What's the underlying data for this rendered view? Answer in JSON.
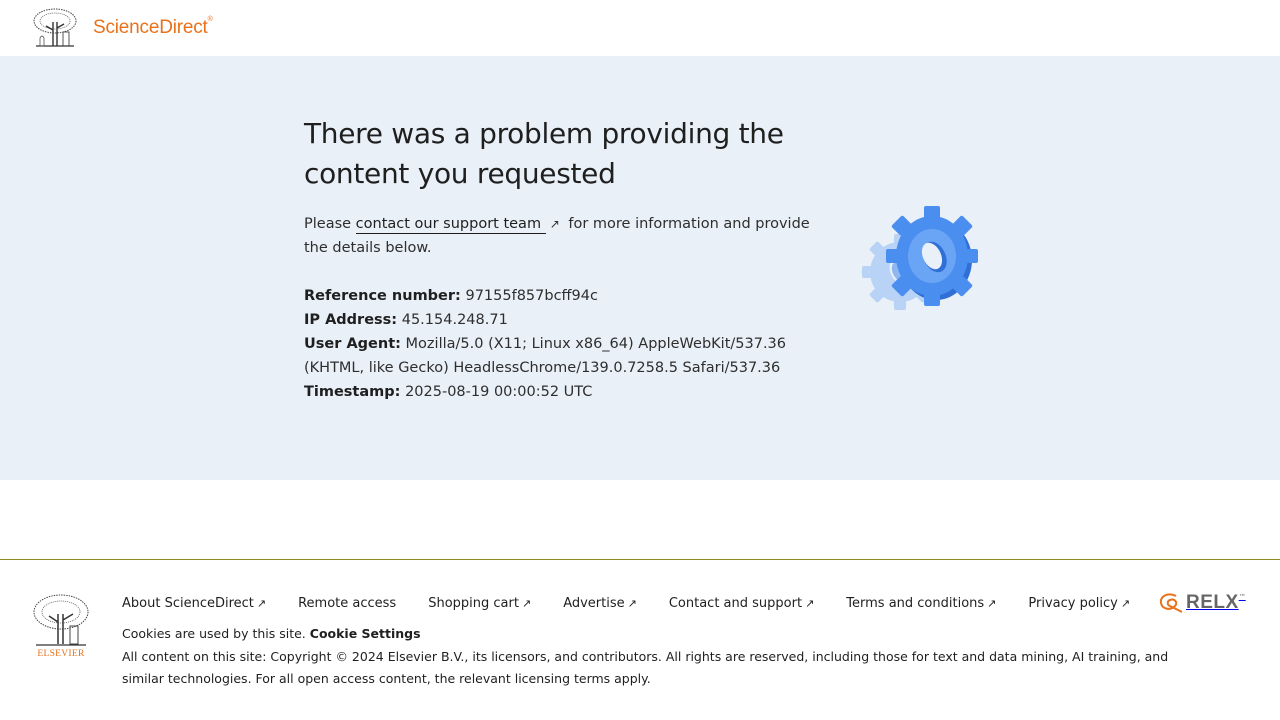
{
  "header": {
    "brand": "ScienceDirect",
    "brand_mark": "®"
  },
  "error": {
    "title": "There was a problem providing the content you requested",
    "intro_before": "Please ",
    "support_link": "contact our support team",
    "intro_after": " for more information and provide the details below.",
    "reference_label": "Reference number:",
    "reference_value": "97155f857bcff94c",
    "ip_label": "IP Address:",
    "ip_value": "45.154.248.71",
    "ua_label": "User Agent:",
    "ua_value": "Mozilla/5.0 (X11; Linux x86_64) AppleWebKit/537.36 (KHTML, like Gecko) HeadlessChrome/139.0.7258.5 Safari/537.36",
    "timestamp_label": "Timestamp:",
    "timestamp_value": "2025-08-19 00:00:52 UTC",
    "illustration": "gear-icon"
  },
  "footer": {
    "logo_text": "ELSEVIER",
    "links": [
      "About ScienceDirect",
      "Remote access",
      "Shopping cart",
      "Advertise",
      "Contact and support",
      "Terms and conditions",
      "Privacy policy"
    ],
    "cookie_text": "Cookies are used by this site.",
    "cookie_settings": "Cookie Settings",
    "copyright": "All content on this site: Copyright © 2024 Elsevier B.V., its licensors, and contributors. All rights are reserved, including those for text and data mining, AI training, and similar technologies. For all open access content, the relevant licensing terms apply.",
    "relx_text": "RELX",
    "relx_tm": "™"
  },
  "colors": {
    "brand_orange": "#e9711c",
    "panel_bg": "#e9f0f8",
    "gear_blue": "#4a8ef0",
    "footer_rule": "#8c8c1e"
  }
}
